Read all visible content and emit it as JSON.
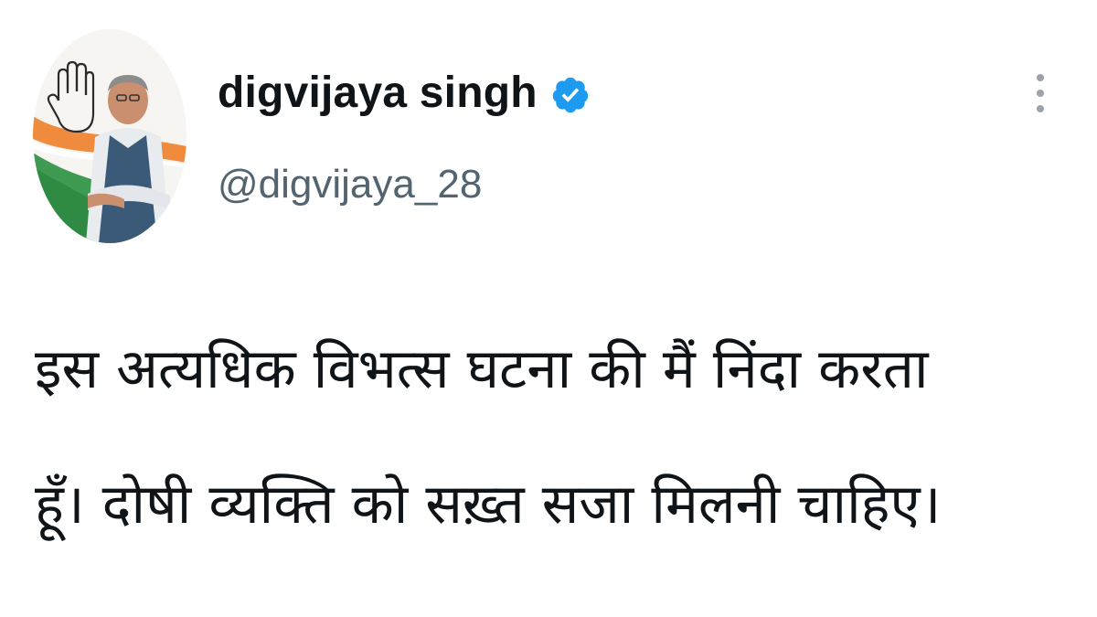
{
  "tweet": {
    "display_name": "digvijaya singh",
    "handle": "@digvijaya_28",
    "verified": true,
    "text_lines": [
      "इस अत्यधिक विभत्स घटना की मैं निंदा करता",
      "हूँ। दोषी व्यक्ति को सख़्त सजा मिलनी चाहिए।"
    ]
  },
  "icons": {
    "verified": "verified-badge-icon",
    "more": "more-options-icon"
  },
  "colors": {
    "verified_badge": "#1d9bf0",
    "handle_text": "#536471",
    "name_text": "#0f1419",
    "more_dots": "#9aa3ab"
  }
}
